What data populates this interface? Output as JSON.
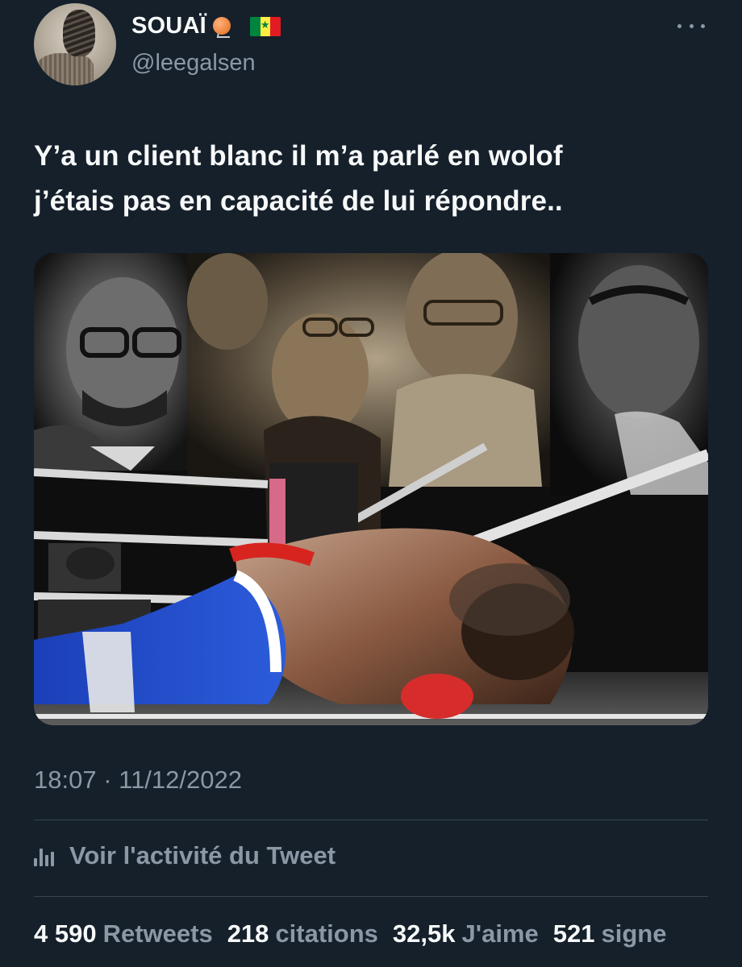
{
  "author": {
    "display_name": "SOUAÏ",
    "handle": "@leegalsen",
    "emoji_icons": [
      "basketball-icon",
      "senegal-flag-icon"
    ]
  },
  "tweet": {
    "text_lines": [
      "Y’a un client blanc il m’a parlé en wolof",
      "j’étais pas en capacité de lui répondre.."
    ],
    "timestamp": "18:07 · 11/12/2022",
    "activity_label": "Voir l'activité du Tweet"
  },
  "stats": {
    "retweets": {
      "count": "4 590",
      "label": "Retweets"
    },
    "quotes": {
      "count": "218",
      "label": "citations"
    },
    "likes": {
      "count": "32,5k",
      "label": "J'aime"
    },
    "bookmarks": {
      "count": "521",
      "label": "signe"
    }
  },
  "colors": {
    "background": "#15202b",
    "text_primary": "#f7f9f9",
    "text_secondary": "#8b98a5",
    "divider": "#38444d"
  }
}
